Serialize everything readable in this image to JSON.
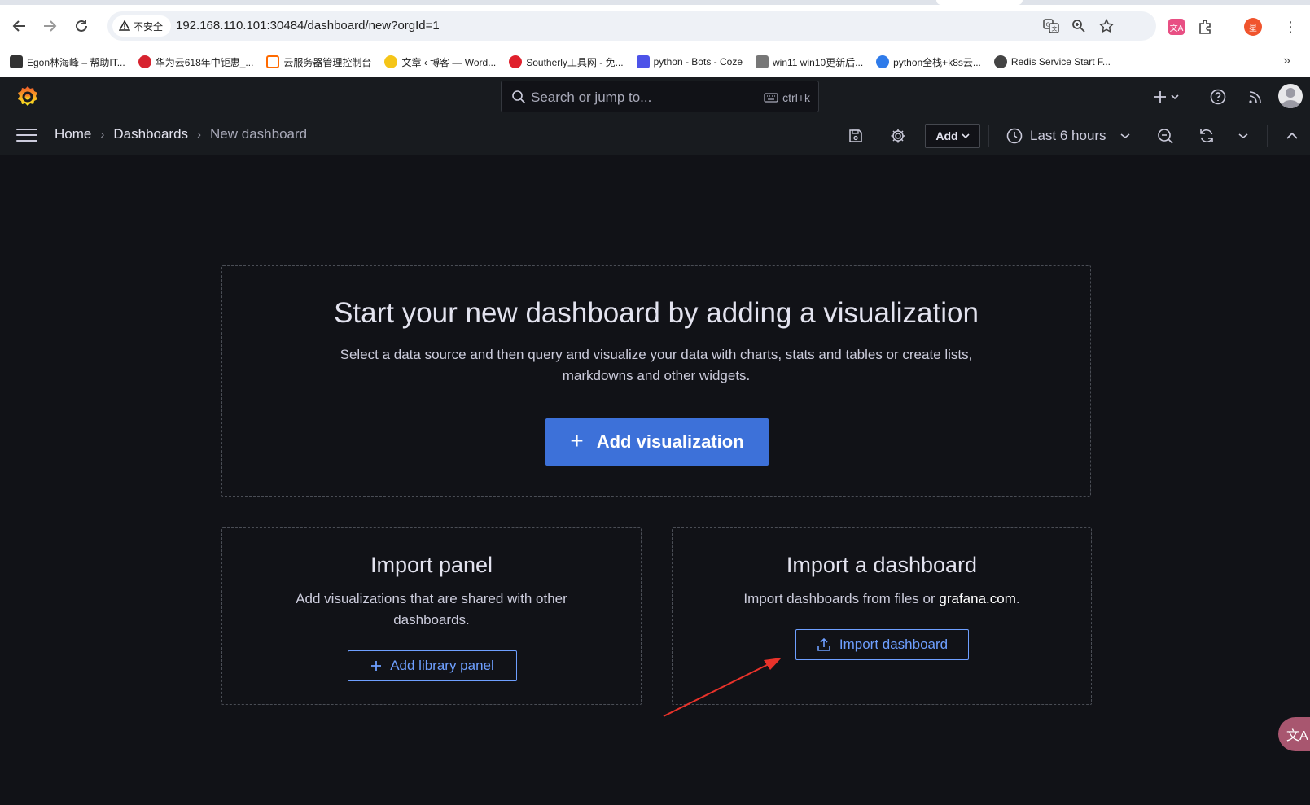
{
  "browser": {
    "security_label": "不安全",
    "url": "192.168.110.101:30484/dashboard/new?orgId=1",
    "bookmarks": [
      {
        "label": "Egon林海峰 – 帮助IT...",
        "color": "#333333"
      },
      {
        "label": "华为云618年中钜惠_...",
        "color": "#d7232f"
      },
      {
        "label": "云服务器管理控制台",
        "color": "#ff6a00"
      },
      {
        "label": "文章 ‹ 博客 — Word...",
        "color": "#f5c518"
      },
      {
        "label": "Southerly工具网 - 免...",
        "color": "#e0202c"
      },
      {
        "label": "python - Bots - Coze",
        "color": "#4d53e8"
      },
      {
        "label": "win11 win10更新后...",
        "color": "#555555"
      },
      {
        "label": "python全栈+k8s云...",
        "color": "#2f7bea"
      },
      {
        "label": "Redis Service Start F...",
        "color": "#444444"
      }
    ],
    "profile_initial": "星"
  },
  "grafana": {
    "search_placeholder": "Search or jump to...",
    "search_shortcut": "ctrl+k",
    "breadcrumbs": [
      "Home",
      "Dashboards",
      "New dashboard"
    ],
    "add_label": "Add",
    "time_range": "Last 6 hours"
  },
  "main": {
    "hero": {
      "title": "Start your new dashboard by adding a visualization",
      "description": "Select a data source and then query and visualize your data with charts, stats and tables or create lists, markdowns and other widgets.",
      "button": "Add visualization"
    },
    "import_panel": {
      "title": "Import panel",
      "description": "Add visualizations that are shared with other dashboards.",
      "button": "Add library panel"
    },
    "import_dashboard": {
      "title": "Import a dashboard",
      "description_prefix": "Import dashboards from files or",
      "description_link": "grafana.com",
      "description_suffix": ".",
      "button": "Import dashboard"
    }
  },
  "colors": {
    "accent": "#3d71d9",
    "link": "#6e9fff",
    "background": "#111217",
    "annotation_arrow": "#e8322a"
  }
}
